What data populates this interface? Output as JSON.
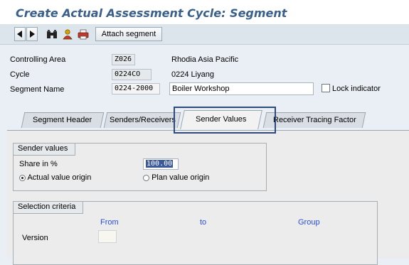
{
  "window": {
    "title": "Create Actual Assessment Cycle: Segment"
  },
  "toolbar": {
    "prev_icon": "triangle-left-icon",
    "next_icon": "triangle-right-icon",
    "find_icon": "binoculars-icon",
    "person_icon": "person-icon",
    "print_icon": "printer-icon",
    "attach_label": "Attach segment"
  },
  "header": {
    "controlling_area": {
      "label": "Controlling Area",
      "code": "Z026",
      "desc": "Rhodia Asia Pacific"
    },
    "cycle": {
      "label": "Cycle",
      "code": "0224CO",
      "desc": "0224 Liyang"
    },
    "segment": {
      "label": "Segment Name",
      "code": "0224-2000",
      "desc": "Boiler Workshop"
    },
    "lock": {
      "label": "Lock indicator",
      "checked": false
    }
  },
  "tabs": [
    {
      "label": "Segment Header"
    },
    {
      "label": "Senders/Receivers"
    },
    {
      "label": "Sender Values",
      "active": true
    },
    {
      "label": "Receiver Tracing Factor"
    }
  ],
  "sender_values": {
    "title": "Sender values",
    "share_label": "Share in %",
    "share_value": "100.00",
    "actual_label": "Actual value origin",
    "plan_label": "Plan value origin",
    "selected": "actual"
  },
  "selection": {
    "title": "Selection criteria",
    "col_from": "From",
    "col_to": "to",
    "col_group": "Group",
    "version_label": "Version",
    "version_value": ""
  },
  "colors": {
    "title": "#3a5f8a",
    "column_heading": "#2b4fd6",
    "highlight": "#2d4a7c"
  }
}
